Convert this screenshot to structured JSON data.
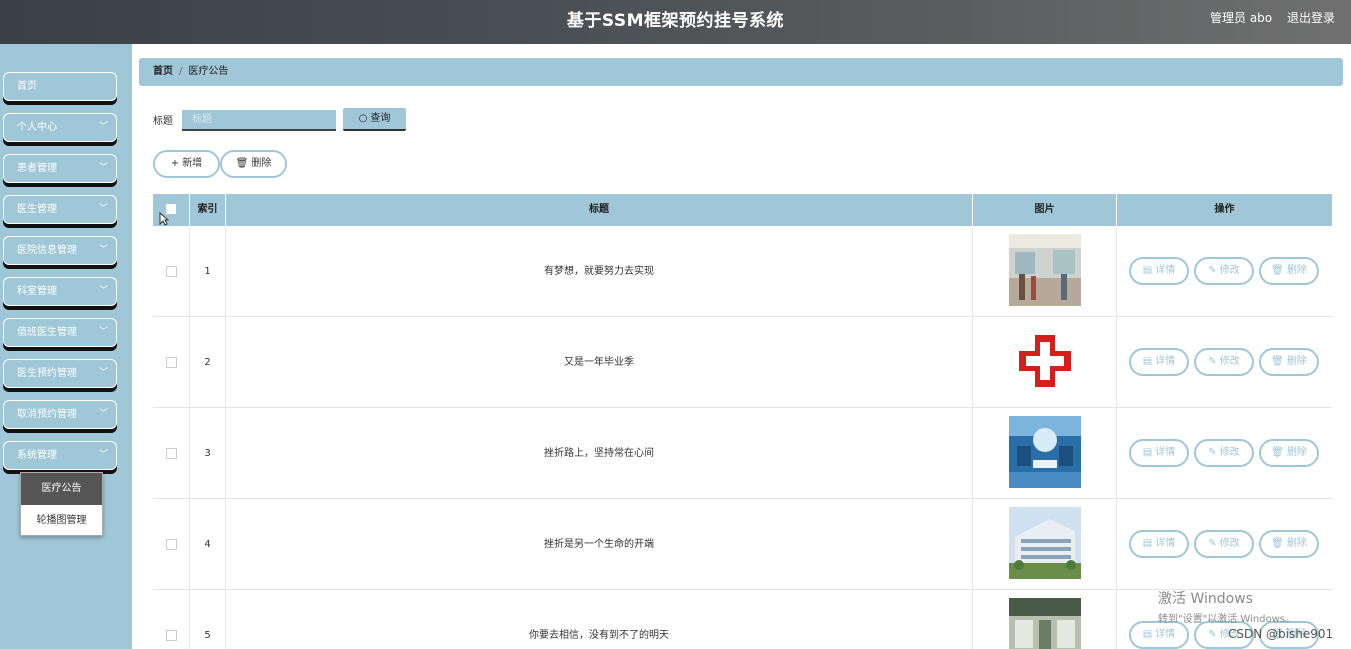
{
  "header": {
    "title": "基于SSM框架预约挂号系统",
    "user": "管理员 abo",
    "logout": "退出登录"
  },
  "sidebar": {
    "items": [
      {
        "label": "首页",
        "chevron": false
      },
      {
        "label": "个人中心",
        "chevron": true
      },
      {
        "label": "患者管理",
        "chevron": true
      },
      {
        "label": "医生管理",
        "chevron": true
      },
      {
        "label": "医院信息管理",
        "chevron": true
      },
      {
        "label": "科室管理",
        "chevron": true
      },
      {
        "label": "值班医生管理",
        "chevron": true
      },
      {
        "label": "医生预约管理",
        "chevron": true
      },
      {
        "label": "取消预约管理",
        "chevron": true
      },
      {
        "label": "系统管理",
        "chevron": true
      }
    ],
    "submenu": [
      {
        "label": "医疗公告",
        "active": true
      },
      {
        "label": "轮播图管理",
        "active": false
      }
    ]
  },
  "breadcrumb": {
    "home": "首页",
    "current": "医疗公告"
  },
  "search": {
    "label": "标题",
    "placeholder": "标题",
    "button": "查询"
  },
  "actions": {
    "add": "新增",
    "delete": "删除"
  },
  "table": {
    "headers": {
      "index": "索引",
      "title": "标题",
      "image": "图片",
      "ops": "操作"
    },
    "row_actions": {
      "detail": "详情",
      "edit": "修改",
      "delete": "删除"
    },
    "rows": [
      {
        "index": "1",
        "title": "有梦想，就要努力去实现",
        "image": "hospital-lobby"
      },
      {
        "index": "2",
        "title": "又是一年毕业季",
        "image": "red-cross"
      },
      {
        "index": "3",
        "title": "挫折路上，坚持常在心间",
        "image": "operating-room"
      },
      {
        "index": "4",
        "title": "挫折是另一个生命的开端",
        "image": "hospital-building"
      },
      {
        "index": "5",
        "title": "你要去相信，没有到不了的明天",
        "image": "ward"
      }
    ]
  },
  "overlay": {
    "activate_title": "激活 Windows",
    "activate_sub": "转到\"设置\"以激活 Windows。",
    "csdn": "CSDN @bishe901"
  },
  "colors": {
    "accent": "#9fc7d7",
    "header": "#4a4f53"
  }
}
